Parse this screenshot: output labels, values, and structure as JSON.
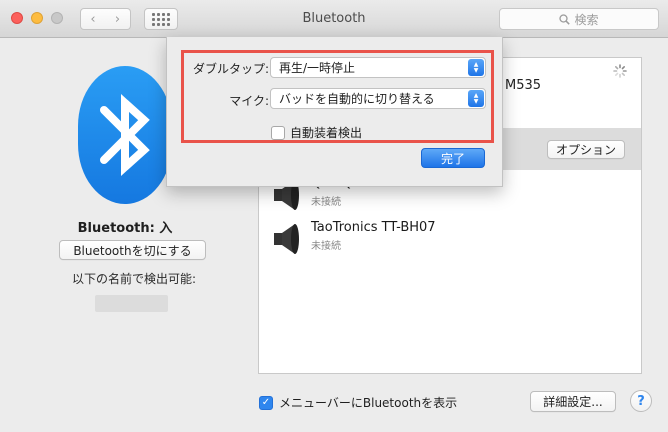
{
  "window": {
    "title": "Bluetooth",
    "search_placeholder": "検索"
  },
  "left_panel": {
    "status": "Bluetooth: 入",
    "toggle_button": "Bluetoothを切にする",
    "discoverable_label": "以下の名前で検出可能:"
  },
  "device_list": {
    "selected_partial_name": "M535",
    "option_button": "オプション",
    "devices": [
      {
        "name": "QCY-QY19",
        "status": "未接続"
      },
      {
        "name": "TaoTronics TT-BH07",
        "status": "未接続"
      }
    ]
  },
  "bottom": {
    "show_in_menu_label": "メニューバーにBluetoothを表示",
    "show_in_menu_checked": true,
    "advanced_button": "詳細設定...",
    "help_label": "?"
  },
  "sheet": {
    "double_tap_label": "ダブルタップ:",
    "double_tap_value": "再生/一時停止",
    "mic_label": "マイク:",
    "mic_value": "バッドを自動的に切り替える",
    "auto_detect_label": "自動装着検出",
    "auto_detect_checked": false,
    "done_button": "完了"
  },
  "colors": {
    "accent": "#2f86ee",
    "highlight_border": "#e9534a",
    "bluetooth_blue": "#1f86ec"
  }
}
